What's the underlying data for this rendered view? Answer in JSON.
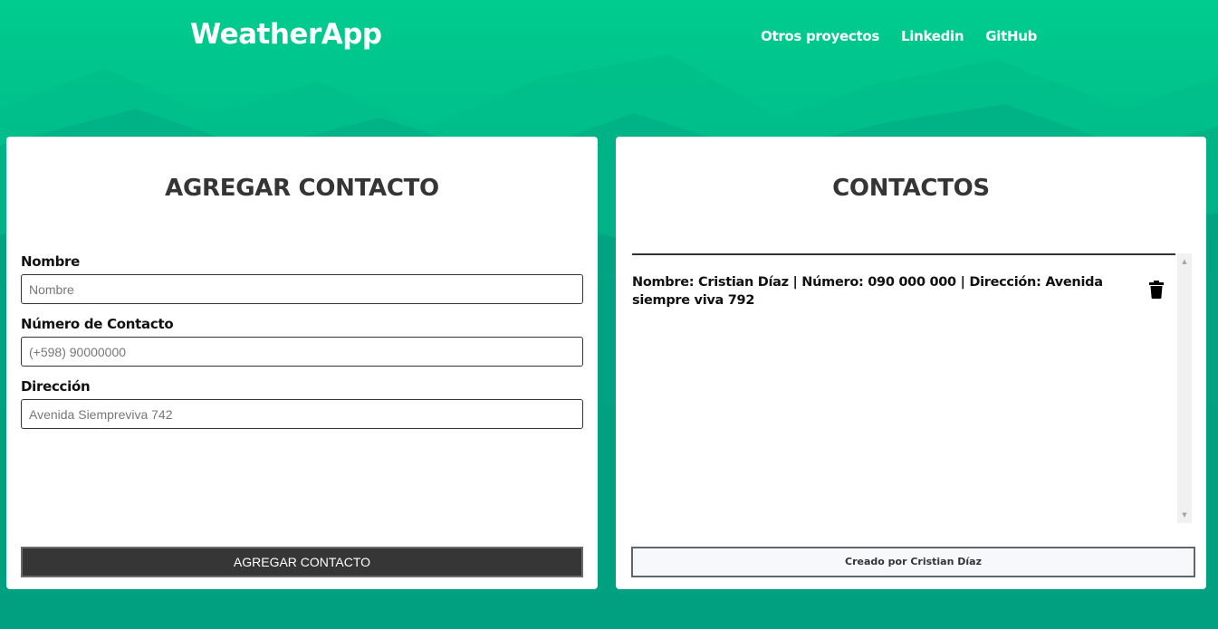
{
  "header": {
    "logo": "WeatherApp",
    "nav": [
      "Otros proyectos",
      "Linkedin",
      "GitHub"
    ]
  },
  "form_panel": {
    "title": "AGREGAR CONTACTO",
    "fields": [
      {
        "label": "Nombre",
        "placeholder": "Nombre",
        "value": ""
      },
      {
        "label": "Número de Contacto",
        "placeholder": "(+598) 90000000",
        "value": ""
      },
      {
        "label": "Dirección",
        "placeholder": "Avenida Siempreviva 742",
        "value": ""
      }
    ],
    "submit_label": "AGREGAR CONTACTO"
  },
  "contacts_panel": {
    "title": "CONTACTOS",
    "items": [
      {
        "text": "Nombre: Cristian Díaz | Número: 090 000 000 | Dirección: Avenida siempre viva 792"
      }
    ],
    "footer": "Creado por Cristian Díaz"
  },
  "colors": {
    "brand_green": "#00cc8e",
    "dark_teal": "#058574",
    "button_dark": "#363636"
  }
}
